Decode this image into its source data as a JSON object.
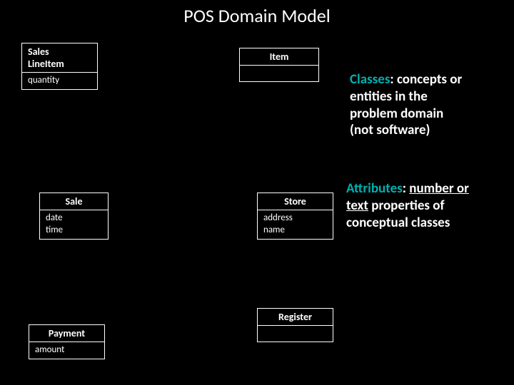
{
  "title": "POS Domain Model",
  "classes": {
    "salesLineItem": {
      "name": "Sales\nLineItem",
      "attrs": "quantity"
    },
    "item": {
      "name": "Item",
      "attrs": ""
    },
    "sale": {
      "name": "Sale",
      "attrs": "date\ntime"
    },
    "store": {
      "name": "Store",
      "attrs": "address\nname"
    },
    "payment": {
      "name": "Payment",
      "attrs": "amount"
    },
    "register": {
      "name": "Register",
      "attrs": ""
    }
  },
  "notes": {
    "classes_label": "Classes",
    "classes_text": ": concepts or\nentities in the\nproblem domain\n(not software)",
    "attributes_label": "Attributes",
    "attributes_text1": ": ",
    "attributes_text2": "number or\ntext",
    "attributes_text3": " properties of\nconceptual classes"
  }
}
